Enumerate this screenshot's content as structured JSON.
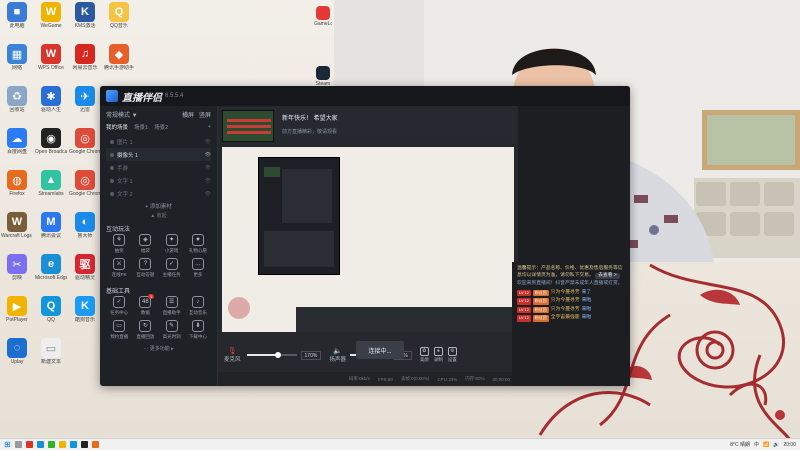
{
  "desktop": {
    "icons": [
      {
        "label": "此电脑",
        "color": "#3a7bd5",
        "glyph": "■"
      },
      {
        "label": "WeGame",
        "color": "#f0b400",
        "glyph": "W"
      },
      {
        "label": "KMS激活",
        "color": "#2c5aa0",
        "glyph": "K"
      },
      {
        "label": "QQ音乐",
        "color": "#f6c445",
        "glyph": "Q"
      },
      {
        "label": "网络",
        "color": "#3c83d8",
        "glyph": "▦"
      },
      {
        "label": "WPS Office",
        "color": "#d9352b",
        "glyph": "W"
      },
      {
        "label": "网易云音乐",
        "color": "#d7281f",
        "glyph": "♫"
      },
      {
        "label": "腾讯手游助手",
        "color": "#e75f2a",
        "glyph": "◆"
      },
      {
        "label": "回收站",
        "color": "#8aa7c8",
        "glyph": "♻"
      },
      {
        "label": "驱动人生",
        "color": "#2b6fd6",
        "glyph": "✱"
      },
      {
        "label": "迅雷",
        "color": "#1a8be8",
        "glyph": "✈"
      },
      {
        "label": "控制面板",
        "color": "#4c9be2",
        "glyph": "▤"
      },
      {
        "label": "百度网盘",
        "color": "#2b7cf4",
        "glyph": "☁"
      },
      {
        "label": "Open Broadcaster Software",
        "color": "#222222",
        "glyph": "◉"
      },
      {
        "label": "Google Chrome",
        "color": "#dd4b39",
        "glyph": "◎"
      },
      {
        "label": "微信",
        "color": "#2cb52c",
        "glyph": "✉"
      },
      {
        "label": "Firefox",
        "color": "#e66b1f",
        "glyph": "◍"
      },
      {
        "label": "Streamlabs",
        "color": "#31c3a2",
        "glyph": "▲"
      },
      {
        "label": "Google Chrome",
        "color": "#dd4b39",
        "glyph": "◎"
      },
      {
        "label": "YY语音",
        "color": "#f5d000",
        "glyph": "Y"
      },
      {
        "label": "Warcraft Logs Uploader",
        "color": "#7a5d3a",
        "glyph": "W"
      },
      {
        "label": "腾讯会议",
        "color": "#2b78f0",
        "glyph": "M"
      },
      {
        "label": "鲁大师",
        "color": "#1a8be8",
        "glyph": "◐"
      },
      {
        "label": "Intel Nav Center",
        "color": "#1c6fd1",
        "glyph": "▲"
      },
      {
        "label": "剪映",
        "color": "#7a6ff0",
        "glyph": "✂"
      },
      {
        "label": "Microsoft Edge",
        "color": "#1b8fd6",
        "glyph": "e"
      },
      {
        "label": "驱动精灵",
        "color": "#d8252f",
        "glyph": "驱"
      },
      {
        "label": "NVIDIA App",
        "color": "#76b900",
        "glyph": "N"
      },
      {
        "label": "PotPlayer",
        "color": "#f2b300",
        "glyph": "▶"
      },
      {
        "label": "QQ",
        "color": "#1296db",
        "glyph": "Q"
      },
      {
        "label": "酷狗音乐",
        "color": "#1b9cf2",
        "glyph": "K"
      },
      {
        "label": "Control Panel",
        "color": "#f0a33a",
        "glyph": "☰"
      },
      {
        "label": "Uplay",
        "color": "#1c6fd1",
        "glyph": "◌"
      },
      {
        "label": "新建文本",
        "color": "#eeeeee",
        "glyph": "▭"
      }
    ],
    "top_right_icons": [
      {
        "label": "GameLoop",
        "color": "#e53935"
      },
      {
        "label": "Steam",
        "color": "#1b2838"
      }
    ]
  },
  "app": {
    "title": "直播伴侣",
    "version": "6.5.5.4",
    "mode": {
      "label": "常规模式 ▼",
      "links": [
        "横屏",
        "竖屏"
      ]
    },
    "scenes_tabs": [
      "我的场景",
      "场景1",
      "场景2",
      "+"
    ],
    "scenes": [
      {
        "name": "图片 1",
        "selected": false
      },
      {
        "name": "摄像头 1",
        "selected": true
      },
      {
        "name": "手游",
        "selected": false
      },
      {
        "name": "文字 1",
        "selected": false
      },
      {
        "name": "文字 2",
        "selected": false
      }
    ],
    "add_source": "+ 添加素材",
    "fold": "▲ 收起",
    "interact": {
      "title": "互动玩法",
      "tools": [
        {
          "label": "抽奖",
          "glyph": "⚘"
        },
        {
          "label": "福袋",
          "glyph": "◈"
        },
        {
          "label": "小游戏",
          "glyph": "✦"
        },
        {
          "label": "礼物心愿",
          "glyph": "♥"
        },
        {
          "label": "连线PK",
          "glyph": "⚔"
        },
        {
          "label": "互动答题",
          "glyph": "?"
        },
        {
          "label": "主播任务",
          "glyph": "✓"
        },
        {
          "label": "更多",
          "glyph": "…"
        }
      ]
    },
    "basic": {
      "title": "基础工具",
      "tools": [
        {
          "label": "任务中心",
          "glyph": "✓"
        },
        {
          "label": "数据",
          "glyph": "48"
        },
        {
          "label": "直播助手",
          "glyph": "☰"
        },
        {
          "label": "互动音乐",
          "glyph": "♪"
        },
        {
          "label": "预约直播",
          "glyph": "▭"
        },
        {
          "label": "直播回放",
          "glyph": "↻"
        },
        {
          "label": "高光时刻",
          "glyph": "✎"
        },
        {
          "label": "下载中心",
          "glyph": "⬇"
        }
      ],
      "badge": "1"
    },
    "more_tools": "⋯ 更多功能 ▸",
    "preview_banner": "新年快乐！ 希望大家",
    "preview_sub": "前方直播精彩，敬请观看",
    "audio": {
      "mic_label": "麦克风",
      "mic_value": "170%",
      "mic_level": 0.62,
      "speaker_label": "扬声器",
      "speaker_value": "80%",
      "speaker_level": 0.8
    },
    "buttons": {
      "beauty": "美颜",
      "record": "录制",
      "settings": "设置",
      "live": "连接中..."
    },
    "status": [
      "码率:0kb/s",
      "FPS:60",
      "丢帧:0(0.00%)",
      "CPU:33%",
      "内存:60%",
      "00:00:00"
    ]
  },
  "chat": {
    "notice": "温馨提示：产品名称、价格、优惠及售后服务等信息均以详情页为准，请勿私下交易。",
    "notice_btn": "去查看 >",
    "sys": "欢迎来到直播间！抖音严禁未成年人直播或打赏。",
    "lines": [
      {
        "level": "LV.12",
        "fan": "粉丝团",
        "user": "只为今蔓寻芳",
        "msg": "来了"
      },
      {
        "level": "LV.12",
        "fan": "粉丝团",
        "user": "只为今蔓寻芳",
        "msg": "来啦"
      },
      {
        "level": "LV.12",
        "fan": "粉丝团",
        "user": "只为今蔓寻芳",
        "msg": "来啦"
      },
      {
        "level": "LV.12",
        "fan": "粉丝团",
        "user": "全宇宙最强鹿",
        "msg": "来啦"
      }
    ]
  },
  "taskbar": {
    "weather": "8°C 晴朗",
    "time": "20:00",
    "lang": "中"
  }
}
